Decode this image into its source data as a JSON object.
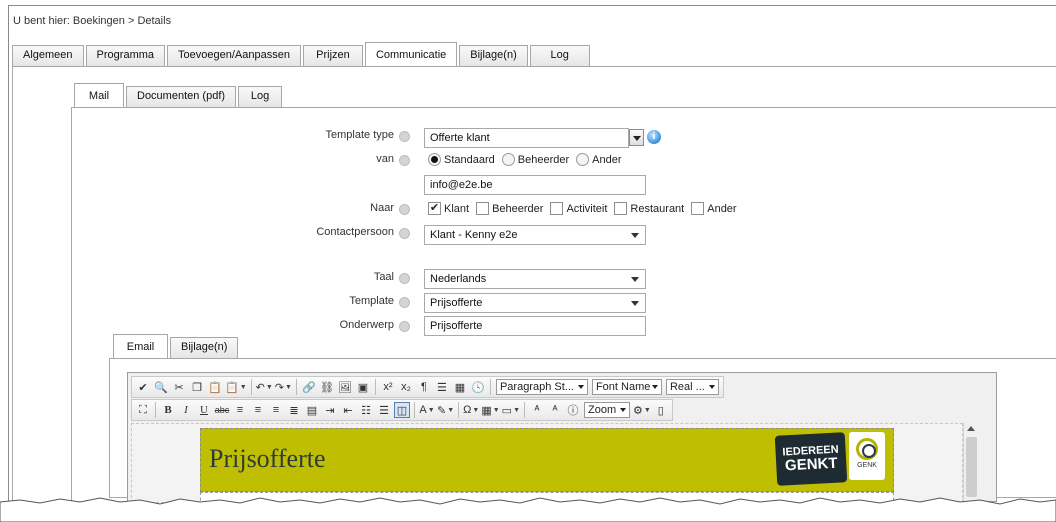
{
  "breadcrumb": "U bent hier: Boekingen > Details",
  "main_tabs": [
    {
      "label": "Algemeen"
    },
    {
      "label": "Programma"
    },
    {
      "label": "Toevoegen/Aanpassen"
    },
    {
      "label": "Prijzen"
    },
    {
      "label": "Communicatie",
      "active": true
    },
    {
      "label": "Bijlage(n)"
    },
    {
      "label": "Log"
    }
  ],
  "sub_tabs": [
    {
      "label": "Mail",
      "active": true
    },
    {
      "label": "Documenten (pdf)"
    },
    {
      "label": "Log"
    }
  ],
  "form": {
    "template_type": {
      "label": "Template type",
      "value": "Offerte klant"
    },
    "van": {
      "label": "van",
      "options": [
        {
          "label": "Standaard",
          "checked": true
        },
        {
          "label": "Beheerder",
          "checked": false
        },
        {
          "label": "Ander",
          "checked": false
        }
      ],
      "email": "info@e2e.be"
    },
    "naar": {
      "label": "Naar",
      "options": [
        {
          "label": "Klant",
          "checked": true
        },
        {
          "label": "Beheerder",
          "checked": false
        },
        {
          "label": "Activiteit",
          "checked": false
        },
        {
          "label": "Restaurant",
          "checked": false
        },
        {
          "label": "Ander",
          "checked": false
        }
      ]
    },
    "contactpersoon": {
      "label": "Contactpersoon",
      "value": "Klant - Kenny e2e"
    },
    "taal": {
      "label": "Taal",
      "value": "Nederlands"
    },
    "template": {
      "label": "Template",
      "value": "Prijsofferte"
    },
    "onderwerp": {
      "label": "Onderwerp",
      "value": "Prijsofferte"
    }
  },
  "email_tabs": [
    {
      "label": "Email",
      "active": true
    },
    {
      "label": "Bijlage(n)"
    }
  ],
  "editor": {
    "paragraph_style": "Paragraph St...",
    "font_name": "Font Name",
    "font_size": "Real ...",
    "zoom": "Zoom",
    "banner_title": "Prijsofferte",
    "logo_line1": "IEDEREEN",
    "logo_line2": "GENKT",
    "seal_label": "GENK",
    "banner_color": "#bfbe00"
  }
}
